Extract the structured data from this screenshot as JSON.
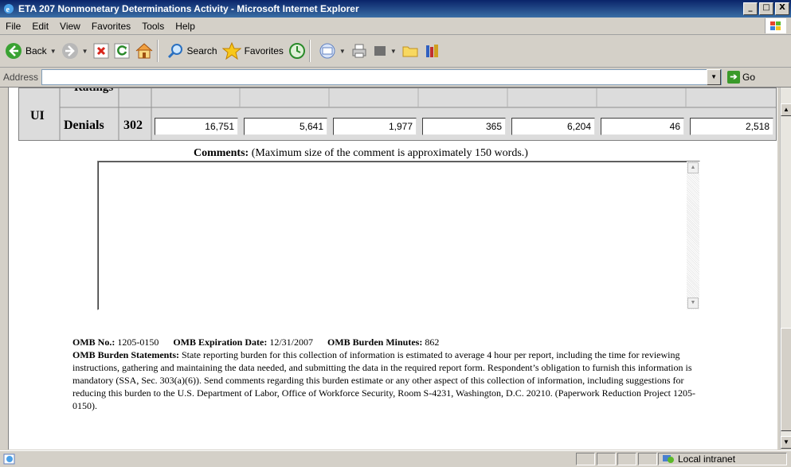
{
  "window": {
    "title": "ETA 207 Nonmonetary Determinations Activity - Microsoft Internet Explorer",
    "min_label": "_",
    "max_label": "□",
    "close_label": "X"
  },
  "menu": [
    "File",
    "Edit",
    "View",
    "Favorites",
    "Tools",
    "Help"
  ],
  "toolbar": {
    "back_label": "Back",
    "search_label": "Search",
    "favorites_label": "Favorites"
  },
  "address": {
    "label": "Address",
    "value": "",
    "go_label": "Go"
  },
  "table": {
    "cut_header": "Ratings",
    "program": "UI",
    "row_label": "Denials",
    "row_code": "302",
    "values": [
      "16,751",
      "5,641",
      "1,977",
      "365",
      "6,204",
      "46",
      "2,518"
    ]
  },
  "comments": {
    "label_bold": "Comments:",
    "label_rest": " (Maximum size of the comment is approximately 150 words.)",
    "value": ""
  },
  "omb": {
    "no_label": "OMB No.:",
    "no_value": " 1205-0150",
    "exp_label": "OMB Expiration Date:",
    "exp_value": " 12/31/2007",
    "minutes_label": "OMB Burden Minutes:",
    "minutes_value": " 862",
    "statement_label": "OMB Burden Statements:",
    "statement_text": " State reporting burden for this collection of information is estimated to average 4 hour per report, including the time for reviewing instructions, gathering and maintaining the data needed, and submitting the data in the required report form. Respondent’s obligation to furnish this information is mandatory (SSA, Sec. 303(a)(6)). Send comments regarding this burden estimate or any other aspect of this collection of information, including suggestions for reducing this burden to the U.S. Department of Labor, Office of Workforce Security, Room S-4231, Washington, D.C. 20210. (Paperwork Reduction Project 1205-0150)."
  },
  "status": {
    "zone": "Local intranet"
  },
  "colors": {
    "titlebar": "#0a246a",
    "chrome": "#d4d0c8",
    "table_bg": "#dcdcdc"
  }
}
